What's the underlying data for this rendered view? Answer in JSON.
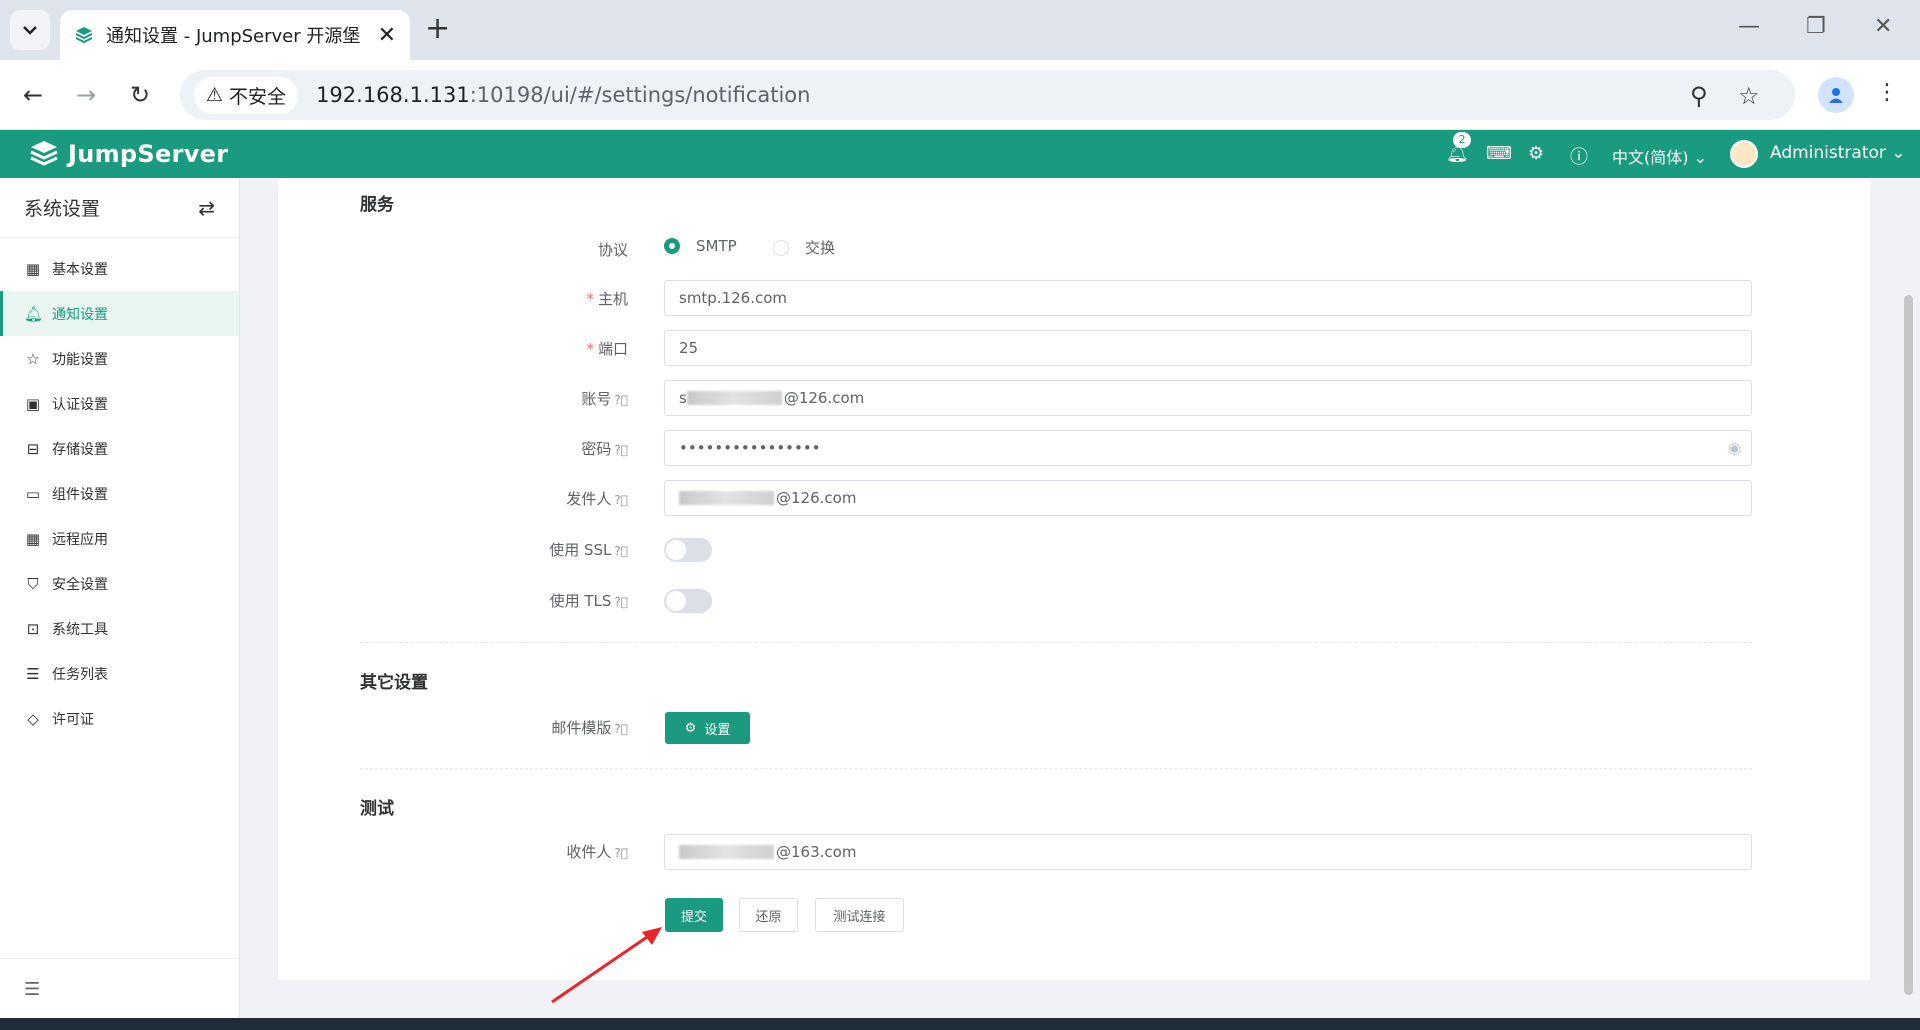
{
  "browser": {
    "tab_title": "通知设置 - JumpServer 开源堡",
    "insecure_label": "不安全",
    "url_host": "192.168.1.131",
    "url_rest": ":10198/ui/#/settings/notification"
  },
  "app": {
    "logo_text": "JumpServer",
    "notification_count": "2",
    "language": "中文(简体)",
    "user": "Administrator",
    "accent_color": "#1a9a7e"
  },
  "sidebar": {
    "title": "系统设置",
    "items": [
      {
        "label": "基本设置",
        "icon": "grid-icon"
      },
      {
        "label": "通知设置",
        "icon": "bell-icon"
      },
      {
        "label": "功能设置",
        "icon": "star-icon"
      },
      {
        "label": "认证设置",
        "icon": "id-card-icon"
      },
      {
        "label": "存储设置",
        "icon": "inbox-icon"
      },
      {
        "label": "组件设置",
        "icon": "monitor-icon"
      },
      {
        "label": "远程应用",
        "icon": "apps-icon"
      },
      {
        "label": "安全设置",
        "icon": "shield-icon"
      },
      {
        "label": "系统工具",
        "icon": "briefcase-icon"
      },
      {
        "label": "任务列表",
        "icon": "task-list-icon"
      },
      {
        "label": "许可证",
        "icon": "diamond-icon"
      }
    ],
    "active_index": 1
  },
  "form": {
    "service_section": "服务",
    "protocol_label": "协议",
    "protocol_options": [
      "SMTP",
      "交换"
    ],
    "host_label": "主机",
    "host_value": "smtp.126.com",
    "port_label": "端口",
    "port_value": "25",
    "account_label": "账号",
    "account_value_prefix": "s",
    "account_value_suffix": "@126.com",
    "password_label": "密码",
    "password_value": "••••••••••••••••",
    "sender_label": "发件人",
    "sender_value_suffix": "@126.com",
    "ssl_label": "使用 SSL",
    "tls_label": "使用 TLS",
    "other_section": "其它设置",
    "mail_template_label": "邮件模版",
    "settings_button": "设置",
    "test_section": "测试",
    "recipient_label": "收件人",
    "recipient_value_suffix": "@163.com",
    "submit_button": "提交",
    "reset_button": "还原",
    "test_connection_button": "测试连接"
  }
}
